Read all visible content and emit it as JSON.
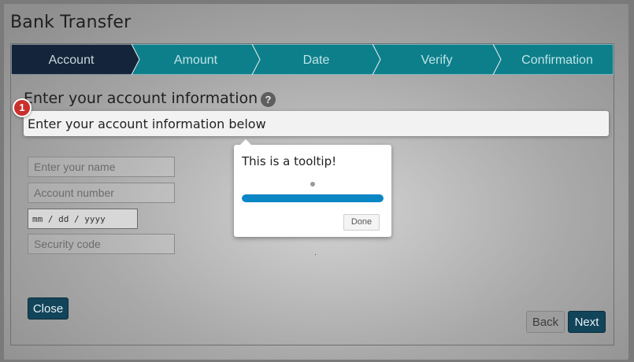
{
  "dialog": {
    "title": "Bank Transfer"
  },
  "steps": [
    {
      "label": "Account",
      "active": true
    },
    {
      "label": "Amount",
      "active": false
    },
    {
      "label": "Date",
      "active": false
    },
    {
      "label": "Verify",
      "active": false
    },
    {
      "label": "Confirmation",
      "active": false
    }
  ],
  "colors": {
    "step_active": "#14243a",
    "step_inactive": "#0d7f8a",
    "primary_button": "#12445a",
    "progress": "#0a86c5",
    "badge": "#c9302c"
  },
  "form": {
    "heading": "Enter your account information",
    "help_icon": "question-circle-icon",
    "help_glyph": "?",
    "name_placeholder": "Enter your name",
    "account_placeholder": "Account number",
    "date_placeholder": "mm / dd / yyyy",
    "security_placeholder": "Security code"
  },
  "tour": {
    "step_badge": "1",
    "info_text": "Enter your account information below",
    "tooltip_text": "This is a tooltip!",
    "progress": 1.0,
    "done_label": "Done"
  },
  "buttons": {
    "close": "Close",
    "back": "Back",
    "next": "Next"
  }
}
